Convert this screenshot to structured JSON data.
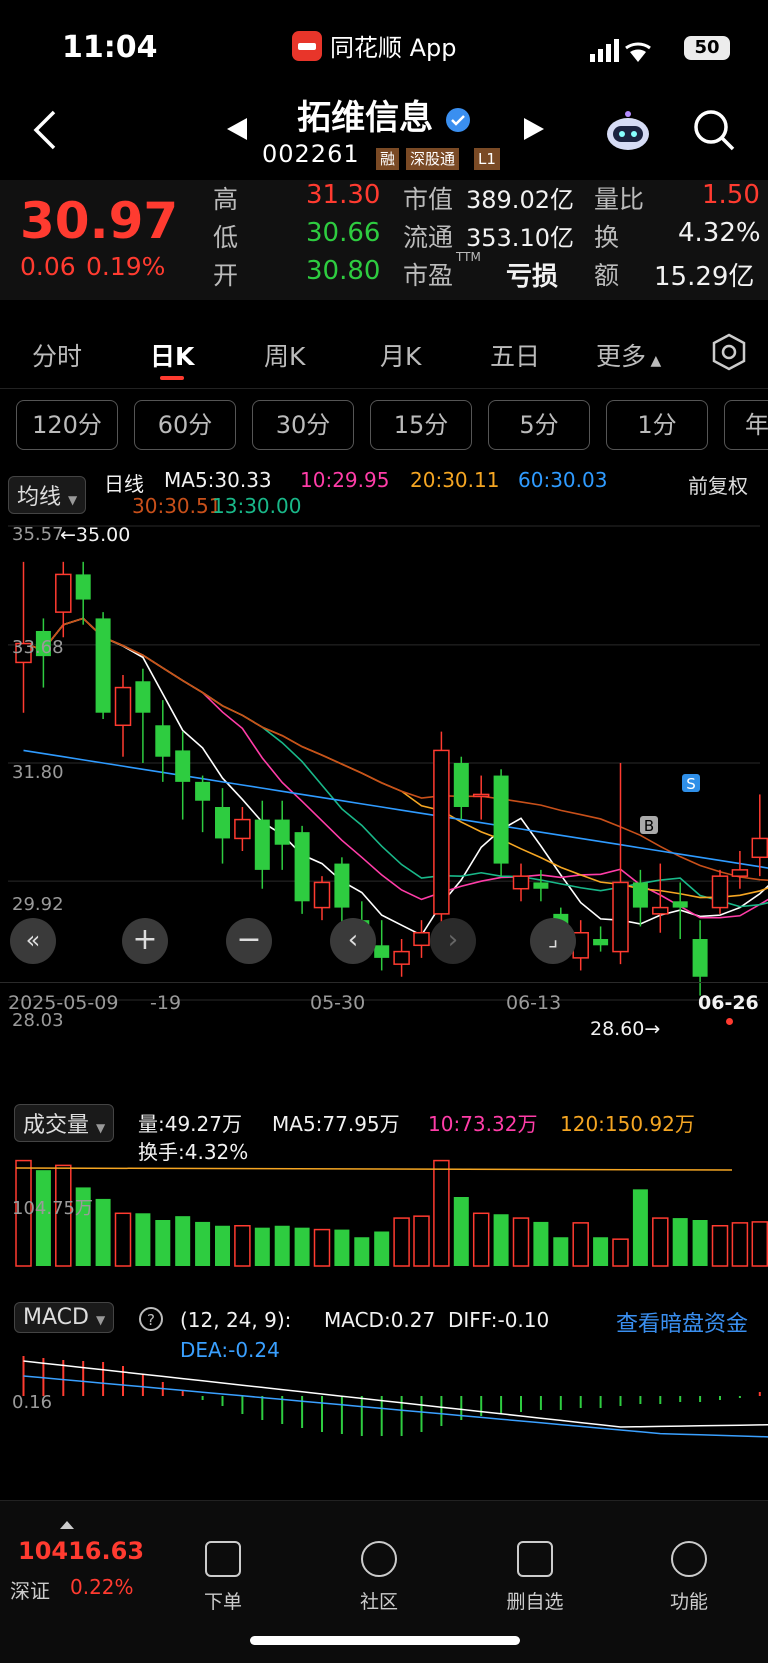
{
  "status_bar": {
    "time": "11:04",
    "app_name": "同花顺 App",
    "battery": "50"
  },
  "header": {
    "stock_name": "拓维信息",
    "stock_code": "002261",
    "tags": [
      "融",
      "深股通",
      "L1"
    ]
  },
  "quote": {
    "price": "30.97",
    "change": "0.06",
    "change_pct": "0.19%",
    "high_label": "高",
    "high": "31.30",
    "low_label": "低",
    "low": "30.66",
    "open_label": "开",
    "open": "30.80",
    "mcap_label": "市值",
    "mcap": "389.02亿",
    "float_label": "流通",
    "float": "353.10亿",
    "pe_label": "市盈",
    "pe_sup": "TTM",
    "pe": "亏损",
    "vr_label": "量比",
    "vr": "1.50",
    "turnover_label": "换",
    "turnover": "4.32%",
    "amount_label": "额",
    "amount": "15.29亿"
  },
  "tabs": [
    "分时",
    "日K",
    "周K",
    "月K",
    "五日",
    "更多"
  ],
  "active_tab": "日K",
  "timeframes": [
    "120分",
    "60分",
    "30分",
    "15分",
    "5分",
    "1分",
    "年"
  ],
  "chart": {
    "indicator_btn": "均线",
    "line_name": "日线",
    "ma5": "MA5:30.33",
    "ma10": "10:29.95",
    "ma20": "20:30.11",
    "ma60": "60:30.03",
    "ma30": "30:30.51",
    "ma13": "13:30.00",
    "adjust": "前复权",
    "y_labels": [
      "35.57",
      "33.68",
      "31.80",
      "29.92",
      "28.03"
    ],
    "high_mark": "←35.00",
    "low_mark": "28.60→",
    "x_labels": [
      "2025-05-09",
      "-19",
      "05-30",
      "06-13",
      "06-26"
    ],
    "signals": [
      "B",
      "S"
    ]
  },
  "volume": {
    "btn": "成交量",
    "vol": "量:49.27万",
    "ma5": "MA5:77.95万",
    "ma10": "10:73.32万",
    "ma120": "120:150.92万",
    "turnover": "换手:4.32%",
    "y_label": "104.75万"
  },
  "macd": {
    "btn": "MACD",
    "params": "(12, 24, 9):",
    "macd": "MACD:0.27",
    "diff": "DIFF:-0.10",
    "dea": "DEA:-0.24",
    "y_label": "0.16",
    "link": "查看暗盘资金"
  },
  "bottom": {
    "index_value": "10416.63",
    "index_name": "深证",
    "index_pct": "0.22%",
    "nav": [
      "下单",
      "社区",
      "删自选",
      "功能"
    ]
  },
  "colors": {
    "up": "#ff3b30",
    "down": "#2ecc40",
    "ma5": "#ffffff",
    "ma10": "#ff3da8",
    "ma20": "#f5a623",
    "ma60": "#2f9bff",
    "ma30": "#c8501a",
    "ma13": "#19b889"
  }
}
